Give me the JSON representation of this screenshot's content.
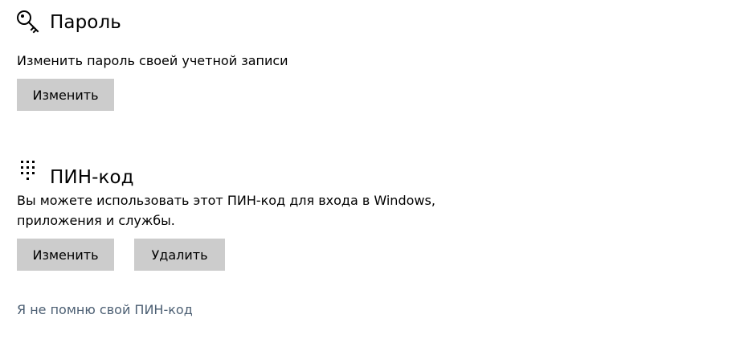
{
  "password": {
    "icon": "key-icon",
    "title": "Пароль",
    "description": "Изменить пароль своей учетной записи",
    "change_label": "Изменить"
  },
  "pin": {
    "icon": "dial-pad-icon",
    "title": "ПИН-код",
    "description_line1": "Вы можете использовать этот ПИН-код для входа в Windows,",
    "description_line2": "приложения и службы.",
    "change_label": "Изменить",
    "remove_label": "Удалить",
    "forgot_link": "Я не помню свой ПИН-код"
  },
  "colors": {
    "button_bg": "#cccccc",
    "link": "#4c5f73"
  }
}
